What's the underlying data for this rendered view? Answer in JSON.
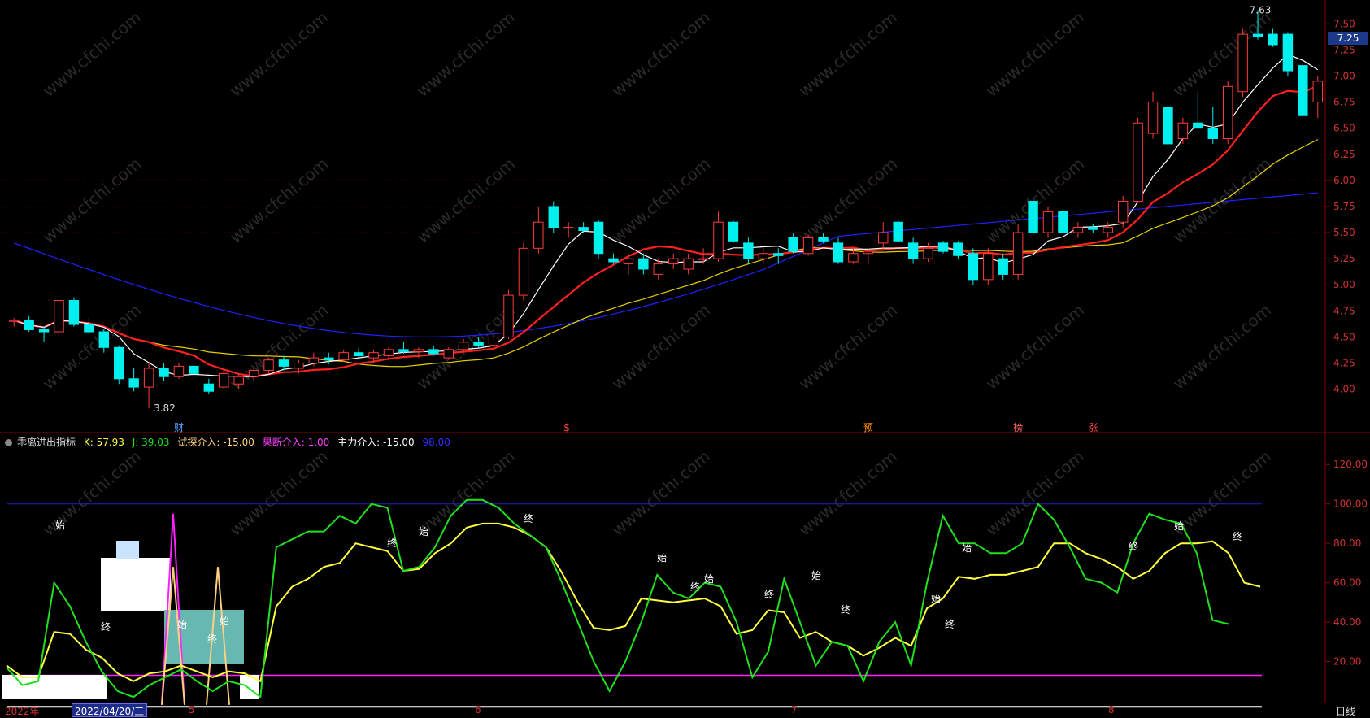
{
  "app": {
    "watermark": "www.cfchi.com"
  },
  "price_panel": {
    "axis_ticks": [
      "7.50",
      "7.25",
      "7.00",
      "6.75",
      "6.50",
      "6.25",
      "6.00",
      "5.75",
      "5.50",
      "5.25",
      "5.00",
      "4.75",
      "4.50",
      "4.25",
      "4.00"
    ],
    "current_price": "7.25",
    "high_label": "7.63",
    "low_label": "3.82",
    "event_markers": [
      {
        "label": "财",
        "color": "#5aa0ff"
      },
      {
        "label": "$",
        "color": "#ff4040"
      },
      {
        "label": "预",
        "color": "#ff8c00"
      },
      {
        "label": "榜",
        "color": "#ff6060"
      },
      {
        "label": "涨",
        "color": "#ff4040"
      }
    ]
  },
  "indicator": {
    "name": "乖离进出指标",
    "k_label": "K: 57.93",
    "j_label": "J: 39.03",
    "try_label": "试探介入: -15.00",
    "decisive_label": "果断介入: 1.00",
    "main_label": "主力介入: -15.00",
    "extra_value": "98.00",
    "axis_ticks": [
      "120.00",
      "100.00",
      "80.00",
      "60.00",
      "40.00",
      "20.00"
    ],
    "start_mark": "始",
    "end_mark": "终"
  },
  "bottom_bar": {
    "year": "2022年",
    "selected_date": "2022/04/20/三",
    "months": [
      "5",
      "6",
      "7",
      "8"
    ],
    "period": "日线"
  },
  "colors": {
    "up": "#ff3b3b",
    "down": "#00f0f0",
    "ma5": "#ffffff",
    "ma10": "#ff2020",
    "ma20": "#e8d000",
    "ma60": "#2020ff",
    "k": "#ffff40",
    "j": "#20e020",
    "magenta": "#ff20ff",
    "axis": "#8b0000"
  },
  "chart_data": [
    {
      "type": "candlestick",
      "ylim": [
        3.6,
        7.65
      ],
      "ohlc": [
        [
          4.65,
          4.68,
          4.6,
          4.66
        ],
        [
          4.66,
          4.7,
          4.55,
          4.57
        ],
        [
          4.57,
          4.6,
          4.45,
          4.55
        ],
        [
          4.55,
          4.95,
          4.5,
          4.85
        ],
        [
          4.85,
          4.88,
          4.6,
          4.62
        ],
        [
          4.62,
          4.68,
          4.52,
          4.55
        ],
        [
          4.55,
          4.58,
          4.35,
          4.4
        ],
        [
          4.4,
          4.42,
          4.05,
          4.1
        ],
        [
          4.1,
          4.2,
          3.98,
          4.02
        ],
        [
          4.02,
          4.25,
          3.82,
          4.2
        ],
        [
          4.2,
          4.25,
          4.08,
          4.12
        ],
        [
          4.12,
          4.25,
          4.1,
          4.22
        ],
        [
          4.22,
          4.25,
          4.1,
          4.15
        ],
        [
          4.05,
          4.1,
          3.95,
          3.98
        ],
        [
          4.02,
          4.18,
          4.0,
          4.15
        ],
        [
          4.05,
          4.15,
          4.0,
          4.12
        ],
        [
          4.12,
          4.2,
          4.08,
          4.18
        ],
        [
          4.18,
          4.3,
          4.15,
          4.28
        ],
        [
          4.28,
          4.32,
          4.18,
          4.22
        ],
        [
          4.2,
          4.28,
          4.15,
          4.25
        ],
        [
          4.25,
          4.35,
          4.22,
          4.3
        ],
        [
          4.3,
          4.35,
          4.24,
          4.28
        ],
        [
          4.28,
          4.38,
          4.26,
          4.35
        ],
        [
          4.35,
          4.4,
          4.3,
          4.32
        ],
        [
          4.3,
          4.38,
          4.25,
          4.35
        ],
        [
          4.32,
          4.4,
          4.28,
          4.38
        ],
        [
          4.38,
          4.45,
          4.34,
          4.36
        ],
        [
          4.36,
          4.4,
          4.3,
          4.38
        ],
        [
          4.38,
          4.42,
          4.32,
          4.34
        ],
        [
          4.3,
          4.4,
          4.28,
          4.38
        ],
        [
          4.38,
          4.48,
          4.35,
          4.45
        ],
        [
          4.45,
          4.5,
          4.4,
          4.42
        ],
        [
          4.42,
          4.52,
          4.4,
          4.5
        ],
        [
          4.5,
          4.95,
          4.48,
          4.9
        ],
        [
          4.9,
          5.4,
          4.85,
          5.35
        ],
        [
          5.35,
          5.75,
          5.3,
          5.6
        ],
        [
          5.75,
          5.8,
          5.5,
          5.55
        ],
        [
          5.55,
          5.6,
          5.45,
          5.55
        ],
        [
          5.55,
          5.6,
          5.5,
          5.52
        ],
        [
          5.6,
          5.62,
          5.25,
          5.3
        ],
        [
          5.25,
          5.3,
          5.2,
          5.22
        ],
        [
          5.2,
          5.3,
          5.1,
          5.25
        ],
        [
          5.25,
          5.3,
          5.1,
          5.15
        ],
        [
          5.1,
          5.25,
          5.05,
          5.2
        ],
        [
          5.2,
          5.3,
          5.15,
          5.25
        ],
        [
          5.15,
          5.3,
          5.1,
          5.25
        ],
        [
          5.25,
          5.35,
          5.2,
          5.25
        ],
        [
          5.25,
          5.7,
          5.22,
          5.6
        ],
        [
          5.6,
          5.62,
          5.4,
          5.42
        ],
        [
          5.4,
          5.45,
          5.2,
          5.25
        ],
        [
          5.25,
          5.35,
          5.2,
          5.3
        ],
        [
          5.3,
          5.35,
          5.2,
          5.28
        ],
        [
          5.45,
          5.5,
          5.3,
          5.32
        ],
        [
          5.3,
          5.48,
          5.28,
          5.45
        ],
        [
          5.45,
          5.5,
          5.4,
          5.42
        ],
        [
          5.4,
          5.45,
          5.2,
          5.22
        ],
        [
          5.22,
          5.35,
          5.2,
          5.3
        ],
        [
          5.3,
          5.35,
          5.2,
          5.32
        ],
        [
          5.4,
          5.6,
          5.35,
          5.5
        ],
        [
          5.6,
          5.62,
          5.4,
          5.42
        ],
        [
          5.4,
          5.45,
          5.2,
          5.25
        ],
        [
          5.25,
          5.4,
          5.22,
          5.35
        ],
        [
          5.4,
          5.42,
          5.3,
          5.32
        ],
        [
          5.4,
          5.42,
          5.25,
          5.28
        ],
        [
          5.3,
          5.35,
          5.0,
          5.05
        ],
        [
          5.05,
          5.35,
          5.0,
          5.3
        ],
        [
          5.25,
          5.3,
          5.05,
          5.1
        ],
        [
          5.1,
          5.58,
          5.05,
          5.5
        ],
        [
          5.8,
          5.82,
          5.48,
          5.5
        ],
        [
          5.5,
          5.75,
          5.45,
          5.7
        ],
        [
          5.7,
          5.72,
          5.48,
          5.5
        ],
        [
          5.5,
          5.6,
          5.45,
          5.55
        ],
        [
          5.55,
          5.58,
          5.5,
          5.53
        ],
        [
          5.5,
          5.6,
          5.45,
          5.55
        ],
        [
          5.6,
          5.85,
          5.55,
          5.8
        ],
        [
          5.8,
          6.6,
          5.78,
          6.55
        ],
        [
          6.45,
          6.85,
          6.4,
          6.75
        ],
        [
          6.7,
          6.72,
          6.3,
          6.35
        ],
        [
          6.4,
          6.6,
          6.35,
          6.55
        ],
        [
          6.55,
          6.85,
          6.5,
          6.5
        ],
        [
          6.5,
          6.7,
          6.35,
          6.4
        ],
        [
          6.4,
          6.95,
          6.35,
          6.9
        ],
        [
          6.85,
          7.45,
          6.8,
          7.4
        ],
        [
          7.4,
          7.63,
          7.35,
          7.38
        ],
        [
          7.4,
          7.45,
          7.28,
          7.3
        ],
        [
          7.4,
          7.42,
          7.0,
          7.05
        ],
        [
          7.1,
          7.12,
          6.6,
          6.62
        ],
        [
          6.75,
          7.0,
          6.6,
          6.95
        ]
      ]
    },
    {
      "type": "line",
      "series": [
        {
          "name": "K",
          "values": [
            18,
            12,
            12,
            35,
            34,
            26,
            22,
            14,
            10,
            14,
            15,
            18,
            15,
            12,
            15,
            14,
            10,
            48,
            58,
            62,
            68,
            70,
            80,
            78,
            76,
            66,
            67,
            75,
            80,
            88,
            90,
            90,
            88,
            84,
            78,
            65,
            50,
            37,
            36,
            38,
            52,
            51,
            50,
            51,
            52,
            48,
            34,
            36,
            46,
            45,
            32,
            35,
            30,
            28,
            23,
            27,
            32,
            28,
            47,
            52,
            63,
            62,
            64,
            64,
            66,
            68,
            80,
            80,
            75,
            72,
            68,
            62,
            66,
            75,
            80,
            80,
            81,
            75,
            60,
            58
          ]
        },
        {
          "name": "J",
          "values": [
            17,
            8,
            10,
            60,
            48,
            30,
            15,
            5,
            2,
            8,
            12,
            16,
            10,
            5,
            10,
            8,
            2,
            78,
            82,
            86,
            86,
            94,
            90,
            100,
            98,
            66,
            68,
            78,
            94,
            102,
            102,
            98,
            90,
            84,
            78,
            60,
            40,
            20,
            5,
            20,
            40,
            64,
            55,
            52,
            60,
            58,
            40,
            12,
            25,
            62,
            40,
            18,
            30,
            28,
            10,
            30,
            40,
            18,
            60,
            94,
            80,
            80,
            75,
            75,
            80,
            100,
            92,
            78,
            62,
            60,
            55,
            80,
            95,
            92,
            90,
            75,
            41,
            39
          ]
        }
      ],
      "ylim": [
        0,
        130
      ]
    }
  ]
}
